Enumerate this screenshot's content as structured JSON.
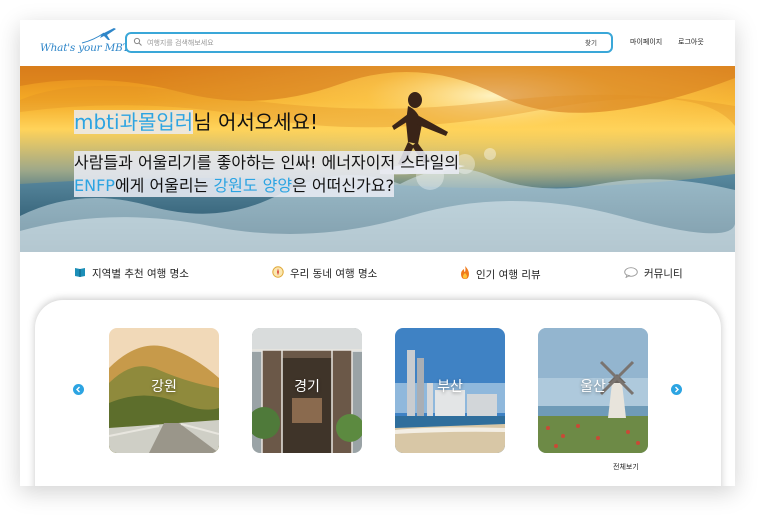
{
  "header": {
    "logo_text": "What's your MBTI",
    "search": {
      "placeholder": "여행지를 검색해보세요",
      "value": "",
      "button_label": "찾기"
    },
    "nav": {
      "mypage": "마이페이지",
      "logout": "로그아웃"
    }
  },
  "hero": {
    "user_name": "mbti과몰입러",
    "greeting_suffix": "님 어서오세요!",
    "line2": "사람들과 어울리기를 좋아하는 인싸! 에너자이저 스타일의",
    "mbti": "ENFP",
    "line3_a": "에게 어울리는 ",
    "region": "강원도 양양",
    "line3_b": "은 어떠신가요?"
  },
  "categories": [
    {
      "label": "지역별 추천 여행 명소",
      "icon": "book-icon"
    },
    {
      "label": "우리 동네 여행 명소",
      "icon": "compass-icon"
    },
    {
      "label": "인기 여행 리뷰",
      "icon": "fire-icon"
    },
    {
      "label": "커뮤니티",
      "icon": "speech-bubble-icon"
    }
  ],
  "cards": [
    {
      "label": "강원"
    },
    {
      "label": "경기"
    },
    {
      "label": "부산"
    },
    {
      "label": "울산"
    }
  ],
  "view_all": "전체보기",
  "colors": {
    "accent": "#2ca4e2",
    "text": "#222222"
  }
}
